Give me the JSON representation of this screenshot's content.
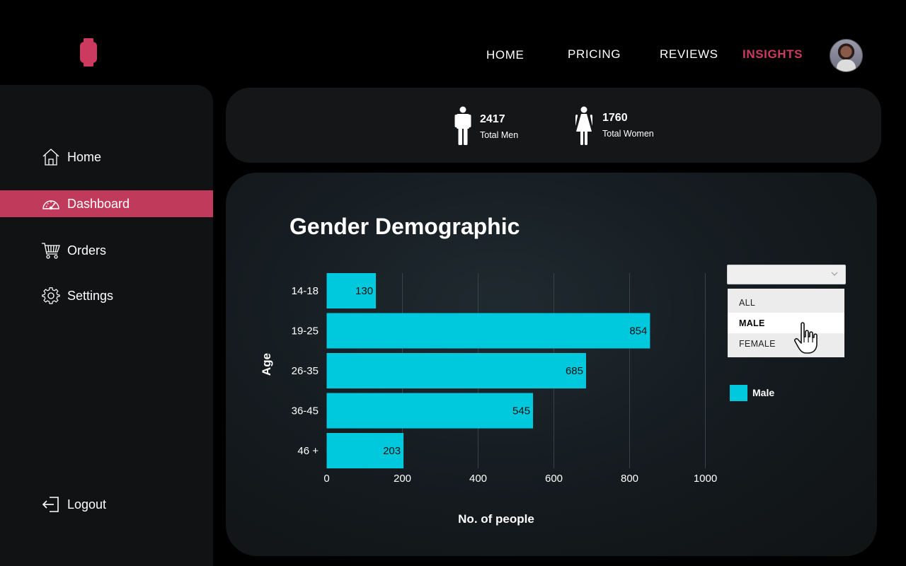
{
  "brand": {
    "logo_icon": "smartwatch-icon",
    "accent": "#cc3b5f"
  },
  "topnav": {
    "items": [
      {
        "label": "HOME",
        "active": false
      },
      {
        "label": "PRICING",
        "active": false
      },
      {
        "label": "REVIEWS",
        "active": false
      },
      {
        "label": "INSIGHTS",
        "active": true
      }
    ],
    "avatar_icon": "user-avatar"
  },
  "sidebar": {
    "items": [
      {
        "label": "Home",
        "icon": "home-icon",
        "active": false
      },
      {
        "label": "Dashboard",
        "icon": "speedometer-icon",
        "active": true
      },
      {
        "label": "Orders",
        "icon": "cart-icon",
        "active": false
      },
      {
        "label": "Settings",
        "icon": "gear-icon",
        "active": false
      }
    ],
    "logout": {
      "label": "Logout",
      "icon": "logout-icon"
    },
    "active_color": "#bf3a5b"
  },
  "stats": {
    "men": {
      "value": "2417",
      "caption": "Total Men",
      "icon": "man-icon"
    },
    "women": {
      "value": "1760",
      "caption": "Total Women",
      "icon": "woman-icon"
    }
  },
  "filter": {
    "selected_value": "",
    "options": [
      "ALL",
      "MALE",
      "FEMALE"
    ],
    "highlighted": "MALE",
    "chevron_icon": "chevron-down-icon",
    "cursor_icon": "hand-pointer-icon"
  },
  "chart_title": "Gender Demographic",
  "chart_data": {
    "type": "bar",
    "orientation": "horizontal",
    "title": "Gender Demographic",
    "categories": [
      "14-18",
      "19-25",
      "26-35",
      "36-45",
      "46 +"
    ],
    "series": [
      {
        "name": "Male",
        "values": [
          130,
          854,
          685,
          545,
          203
        ],
        "color": "#00c9dd"
      }
    ],
    "xlabel": "No. of people",
    "ylabel": "Age",
    "xlim": [
      0,
      1000
    ],
    "xticks": [
      "0",
      "200",
      "400",
      "600",
      "800",
      "1000"
    ],
    "grid": true,
    "legend": "right",
    "data_labels": [
      "130",
      "854",
      "685",
      "545",
      "203"
    ]
  }
}
